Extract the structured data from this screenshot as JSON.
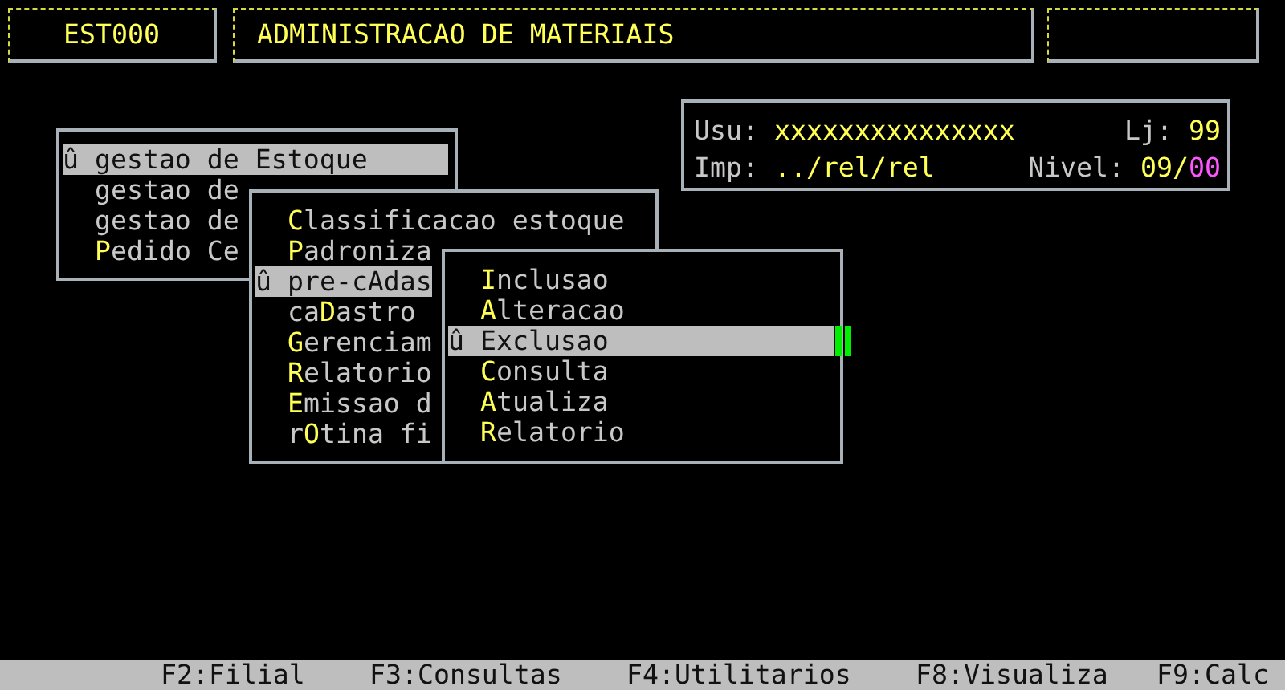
{
  "header": {
    "code": "EST000",
    "title": "ADMINISTRACAO DE MATERIAIS"
  },
  "info": {
    "user_label": "Usu:",
    "user": "xxxxxxxxxxxxxxx",
    "store_label": "Lj:",
    "store": "99",
    "printer_label": "Imp:",
    "printer": "../rel/rel",
    "level_label": "Nivel:",
    "level_value": "09/",
    "level_extra": "00"
  },
  "menus": [
    {
      "items": [
        {
          "marker": "û",
          "before": "gestao de ",
          "key": "E",
          "after": "stoque",
          "selected": true
        },
        {
          "before": "gestao de",
          "selected": false
        },
        {
          "before": "gestao de",
          "selected": false
        },
        {
          "key": "P",
          "after": "edido Ce",
          "selected": false
        }
      ]
    },
    {
      "items": [
        {
          "key": "C",
          "after": "lassificacao estoque",
          "selected": false
        },
        {
          "key": "P",
          "after": "adroniza",
          "selected": false
        },
        {
          "marker": "û",
          "before": "pre-cAdas",
          "selected": true
        },
        {
          "before": "ca",
          "key": "D",
          "after": "astro",
          "selected": false
        },
        {
          "key": "G",
          "after": "erenciam",
          "selected": false
        },
        {
          "key": "R",
          "after": "elatorio",
          "selected": false
        },
        {
          "key": "E",
          "after": "missao d",
          "selected": false
        },
        {
          "before": "r",
          "key": "O",
          "after": "tina fi",
          "selected": false
        }
      ]
    },
    {
      "items": [
        {
          "key": "I",
          "after": "nclusao",
          "selected": false
        },
        {
          "key": "A",
          "after": "lteracao",
          "selected": false
        },
        {
          "marker": "û",
          "before": "Exclusao",
          "selected": true
        },
        {
          "key": "C",
          "after": "onsulta",
          "selected": false
        },
        {
          "key": "A",
          "after": "tualiza",
          "selected": false
        },
        {
          "key": "R",
          "after": "elatorio",
          "selected": false
        }
      ]
    }
  ],
  "function_keys": [
    "F2:Filial",
    "F3:Consultas",
    "F4:Utilitarios",
    "F8:Visualiza",
    "F9:Calc"
  ]
}
